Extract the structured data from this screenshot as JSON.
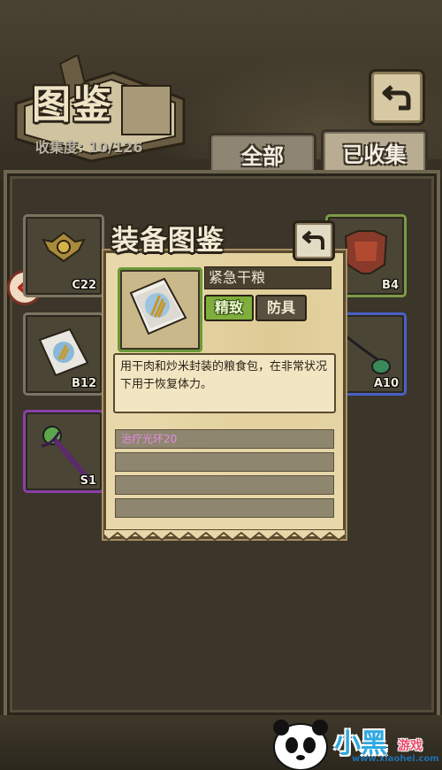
{
  "header": {
    "title": "图鉴",
    "collect_label": "收集度:",
    "collect_value": "10/126"
  },
  "tabs": [
    {
      "label": "全部",
      "active": false
    },
    {
      "label": "已收集",
      "active": true
    }
  ],
  "grid": [
    {
      "code": "C22",
      "rarity": "normal",
      "icon": "emblem-icon"
    },
    {
      "code": "B4",
      "rarity": "green",
      "icon": "armor-icon"
    },
    {
      "code": "B12",
      "rarity": "green",
      "icon": "ration-pack-icon"
    },
    {
      "code": "A10",
      "rarity": "blue",
      "icon": "amulet-icon"
    },
    {
      "code": "S1",
      "rarity": "purple",
      "icon": "staff-icon"
    }
  ],
  "modal": {
    "title": "装备图鉴",
    "item_name": "紧急干粮",
    "quality_tag": "精致",
    "type_tag": "防具",
    "description": "用干肉和炒米封装的粮食包，在非常状况下用于恢复体力。",
    "attributes": [
      "治疗光环20",
      "",
      "",
      ""
    ]
  },
  "watermark": {
    "brand": "小黑",
    "brand_sub": "游戏",
    "url": "www.xiaohei.com"
  },
  "colors": {
    "quality_green": "#7fae3c",
    "attr_pink": "#e58ae8",
    "slot_purple": "#8a3fa8",
    "slot_blue": "#4a5fc8"
  }
}
